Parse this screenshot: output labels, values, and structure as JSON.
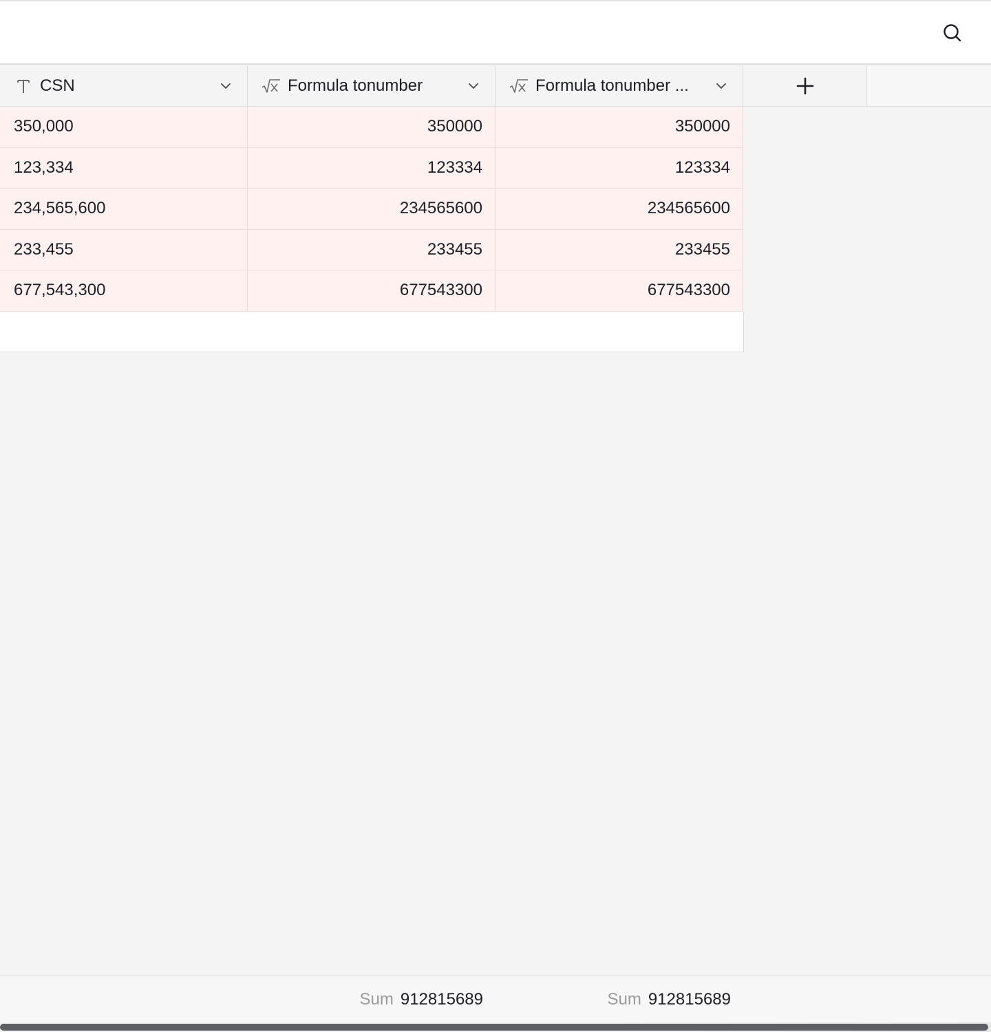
{
  "toolbar": {
    "search_icon": "search-icon"
  },
  "columns": [
    {
      "type_icon": "text-type-icon",
      "label": "CSN",
      "align": "left"
    },
    {
      "type_icon": "formula-icon",
      "label": "Formula tonumber",
      "align": "right"
    },
    {
      "type_icon": "formula-icon",
      "label": "Formula tonumber ...",
      "align": "right"
    }
  ],
  "add_column_icon": "plus-icon",
  "rows": [
    [
      "350,000",
      "350000",
      "350000"
    ],
    [
      "123,334",
      "123334",
      "123334"
    ],
    [
      "234,565,600",
      "234565600",
      "234565600"
    ],
    [
      "233,455",
      "233455",
      "233455"
    ],
    [
      "677,543,300",
      "677543300",
      "677543300"
    ]
  ],
  "summary": [
    {
      "label": "",
      "value": ""
    },
    {
      "label": "Sum",
      "value": "912815689"
    },
    {
      "label": "Sum",
      "value": "912815689"
    }
  ],
  "colors": {
    "row_highlight": "#fff1f0",
    "header_bg": "#f4f4f4",
    "canvas_bg": "#f4f4f4"
  }
}
